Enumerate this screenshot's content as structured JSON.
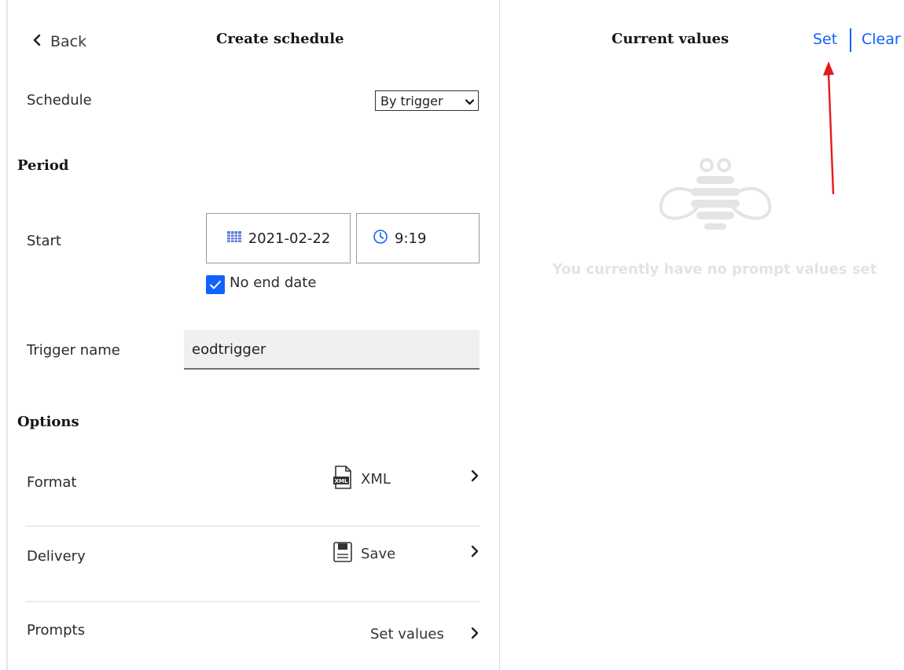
{
  "left_panel": {
    "back_label": "Back",
    "title": "Create schedule",
    "schedule": {
      "label": "Schedule",
      "value": "By trigger"
    },
    "period": {
      "heading": "Period",
      "start_label": "Start",
      "date": "2021-02-22",
      "time": "9:19",
      "no_end_date_label": "No end date",
      "no_end_date_checked": true
    },
    "trigger": {
      "label": "Trigger name",
      "value": "eodtrigger"
    },
    "options": {
      "heading": "Options",
      "format": {
        "label": "Format",
        "value": "XML",
        "icon": "xml-file-icon"
      },
      "delivery": {
        "label": "Delivery",
        "value": "Save",
        "icon": "save-icon"
      },
      "prompts": {
        "label": "Prompts",
        "value": "Set values"
      }
    }
  },
  "right_panel": {
    "title": "Current values",
    "set_label": "Set",
    "clear_label": "Clear",
    "empty_message": "You currently have no prompt values set",
    "empty_icon": "bee-icon"
  },
  "annotation": {
    "type": "red-arrow",
    "color": "#e21b1b",
    "points_to": "Set"
  },
  "colors": {
    "accent": "#0f62fe",
    "text": "#161616",
    "muted": "#e3e3e3",
    "annotation": "#e21b1b"
  }
}
